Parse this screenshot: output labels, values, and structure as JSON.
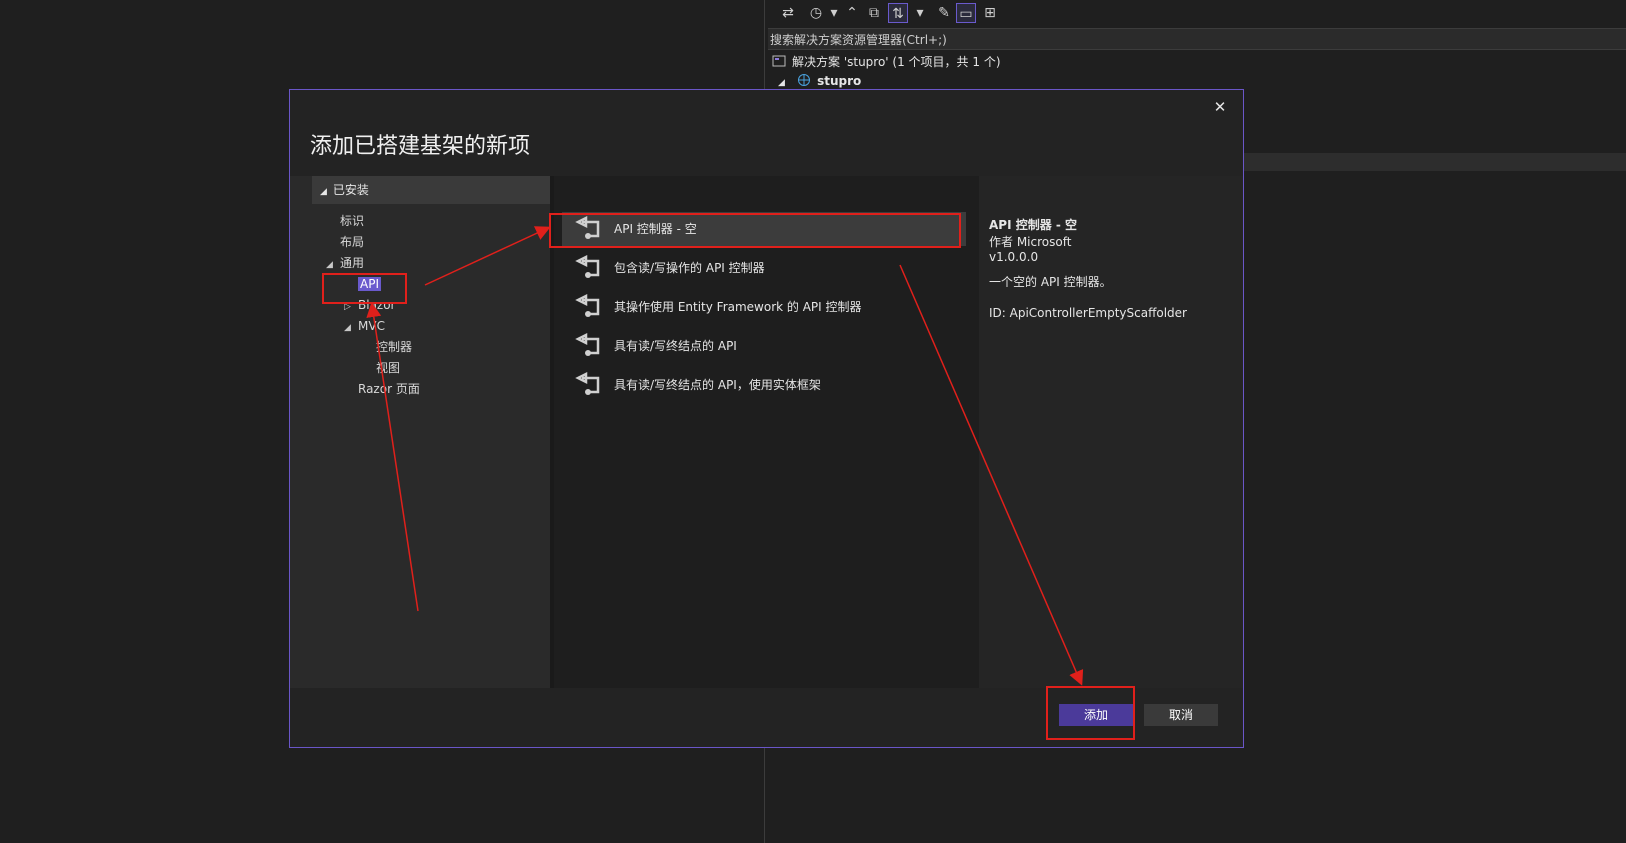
{
  "solution_explorer": {
    "search_placeholder": "搜索解决方案资源管理器(Ctrl+;)",
    "solution_label": "解决方案 'stupro' (1 个项目，共 1 个)",
    "project_label": "stupro"
  },
  "dialog": {
    "title": "添加已搭建基架的新项",
    "installed_label": "已安装",
    "tree": [
      {
        "label": "标识"
      },
      {
        "label": "布局"
      },
      {
        "label": "通用"
      },
      {
        "label": "API"
      },
      {
        "label": "Blazor"
      },
      {
        "label": "MVC"
      },
      {
        "label": "控制器"
      },
      {
        "label": "视图"
      },
      {
        "label": "Razor 页面"
      }
    ],
    "templates": [
      {
        "label": "API 控制器 - 空"
      },
      {
        "label": "包含读/写操作的 API 控制器"
      },
      {
        "label": "其操作使用 Entity Framework 的 API 控制器"
      },
      {
        "label": "具有读/写终结点的 API"
      },
      {
        "label": "具有读/写终结点的 API，使用实体框架"
      }
    ],
    "details": {
      "name": "API 控制器 - 空",
      "author": "作者 Microsoft",
      "version": "v1.0.0.0",
      "description": "一个空的 API 控制器。",
      "id": "ID: ApiControllerEmptyScaffolder"
    },
    "add_button": "添加",
    "cancel_button": "取消"
  },
  "colors": {
    "accent": "#6a56c8",
    "annotation": "#e0201b"
  }
}
